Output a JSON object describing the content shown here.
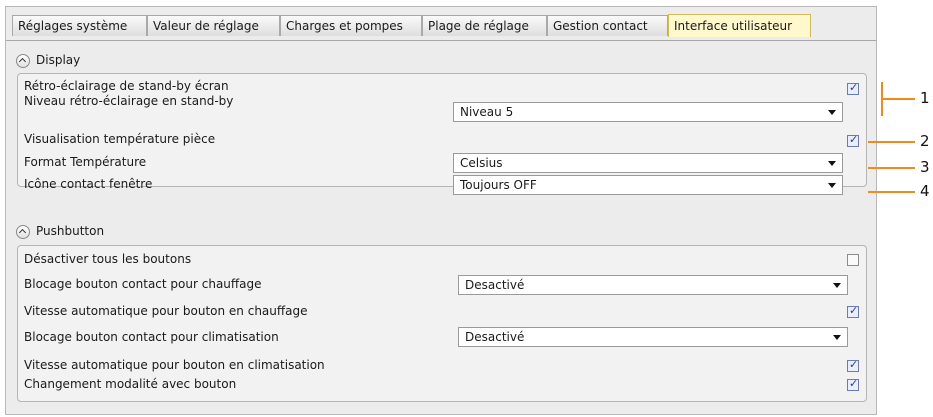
{
  "tabs": [
    {
      "label": "Réglages système"
    },
    {
      "label": "Valeur de réglage"
    },
    {
      "label": "Charges et pompes"
    },
    {
      "label": "Plage de réglage"
    },
    {
      "label": "Gestion contact"
    },
    {
      "label": "Interface utilisateur",
      "active": true
    }
  ],
  "display": {
    "title": "Display",
    "rows": [
      {
        "label": "Rétro-éclairage de stand-by écran",
        "checkbox": true
      },
      {
        "label": "Niveau rétro-éclairage en stand-by",
        "select": "Niveau 5"
      },
      {
        "label": "Visualisation température pièce",
        "checkbox": true
      },
      {
        "label": "Format Température",
        "select": "Celsius"
      },
      {
        "label": "Icône contact fenêtre",
        "select": "Toujours OFF"
      }
    ]
  },
  "pushbutton": {
    "title": "Pushbutton",
    "rows": [
      {
        "label": "Désactiver tous les boutons",
        "checkbox": false
      },
      {
        "label": "Blocage bouton contact pour chauffage",
        "select": "Desactivé"
      },
      {
        "label": "Vitesse automatique pour bouton en chauffage",
        "checkbox": true
      },
      {
        "label": "Blocage bouton contact pour climatisation",
        "select": "Desactivé"
      },
      {
        "label": "Vitesse automatique pour bouton en climatisation",
        "checkbox": true
      },
      {
        "label": "Changement modalité avec bouton",
        "checkbox": true
      }
    ]
  },
  "callouts": [
    "1",
    "2",
    "3",
    "4"
  ],
  "colors": {
    "accent": "#f08a1c",
    "active_tab": "#fff8cc"
  }
}
